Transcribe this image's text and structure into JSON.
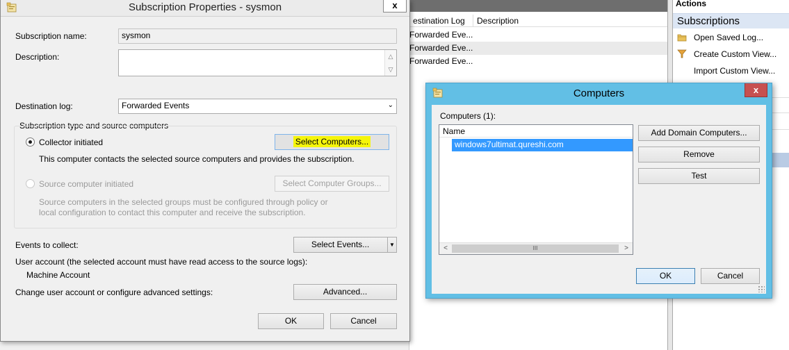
{
  "background": {
    "list_columns": [
      "estination Log",
      "Description"
    ],
    "list_rows": [
      "Forwarded Eve...",
      "Forwarded Eve...",
      "Forwarded Eve..."
    ],
    "actions_title": "Actions",
    "actions_section": "Subscriptions",
    "actions_items": [
      {
        "label": "Open Saved Log...",
        "icon": "folder-icon"
      },
      {
        "label": "Create Custom View...",
        "icon": "filter-icon"
      },
      {
        "label": "Import Custom View...",
        "icon": ""
      }
    ]
  },
  "subscription_dialog": {
    "title": "Subscription Properties - sysmon",
    "close_glyph": "x",
    "name_label": "Subscription name:",
    "name_value": "sysmon",
    "description_label": "Description:",
    "description_value": "",
    "destination_label": "Destination log:",
    "destination_value": "Forwarded Events",
    "group_title": "Subscription type and source computers",
    "collector_label": "Collector initiated",
    "collector_selected": true,
    "select_computers_label": "Select Computers...",
    "collector_desc": "This computer contacts the selected source computers and provides the subscription.",
    "source_label": "Source computer initiated",
    "select_groups_label": "Select Computer Groups...",
    "source_desc_1": "Source computers in the selected groups must be configured through policy or",
    "source_desc_2": "local configuration to contact this computer and receive the subscription.",
    "events_label": "Events to collect:",
    "select_events_label": "Select Events...",
    "user_account_label": "User account (the selected account must have read access to the source logs):",
    "user_account_value": "Machine Account",
    "advanced_label_text": "Change user account or configure advanced settings:",
    "advanced_button": "Advanced...",
    "ok": "OK",
    "cancel": "Cancel"
  },
  "computers_dialog": {
    "title": "Computers",
    "close_glyph": "x",
    "count_label": "Computers (1):",
    "column_name": "Name",
    "computers": [
      "windows7ultimat.qureshi.com"
    ],
    "add_button": "Add Domain Computers...",
    "remove_button": "Remove",
    "test_button": "Test",
    "ok": "OK",
    "cancel": "Cancel",
    "scroll_thumb_glyph": "III"
  },
  "colors": {
    "active_title": "#62bfe5",
    "close_red": "#c75050",
    "selection": "#3399ff",
    "highlight": "#f5f50a"
  }
}
